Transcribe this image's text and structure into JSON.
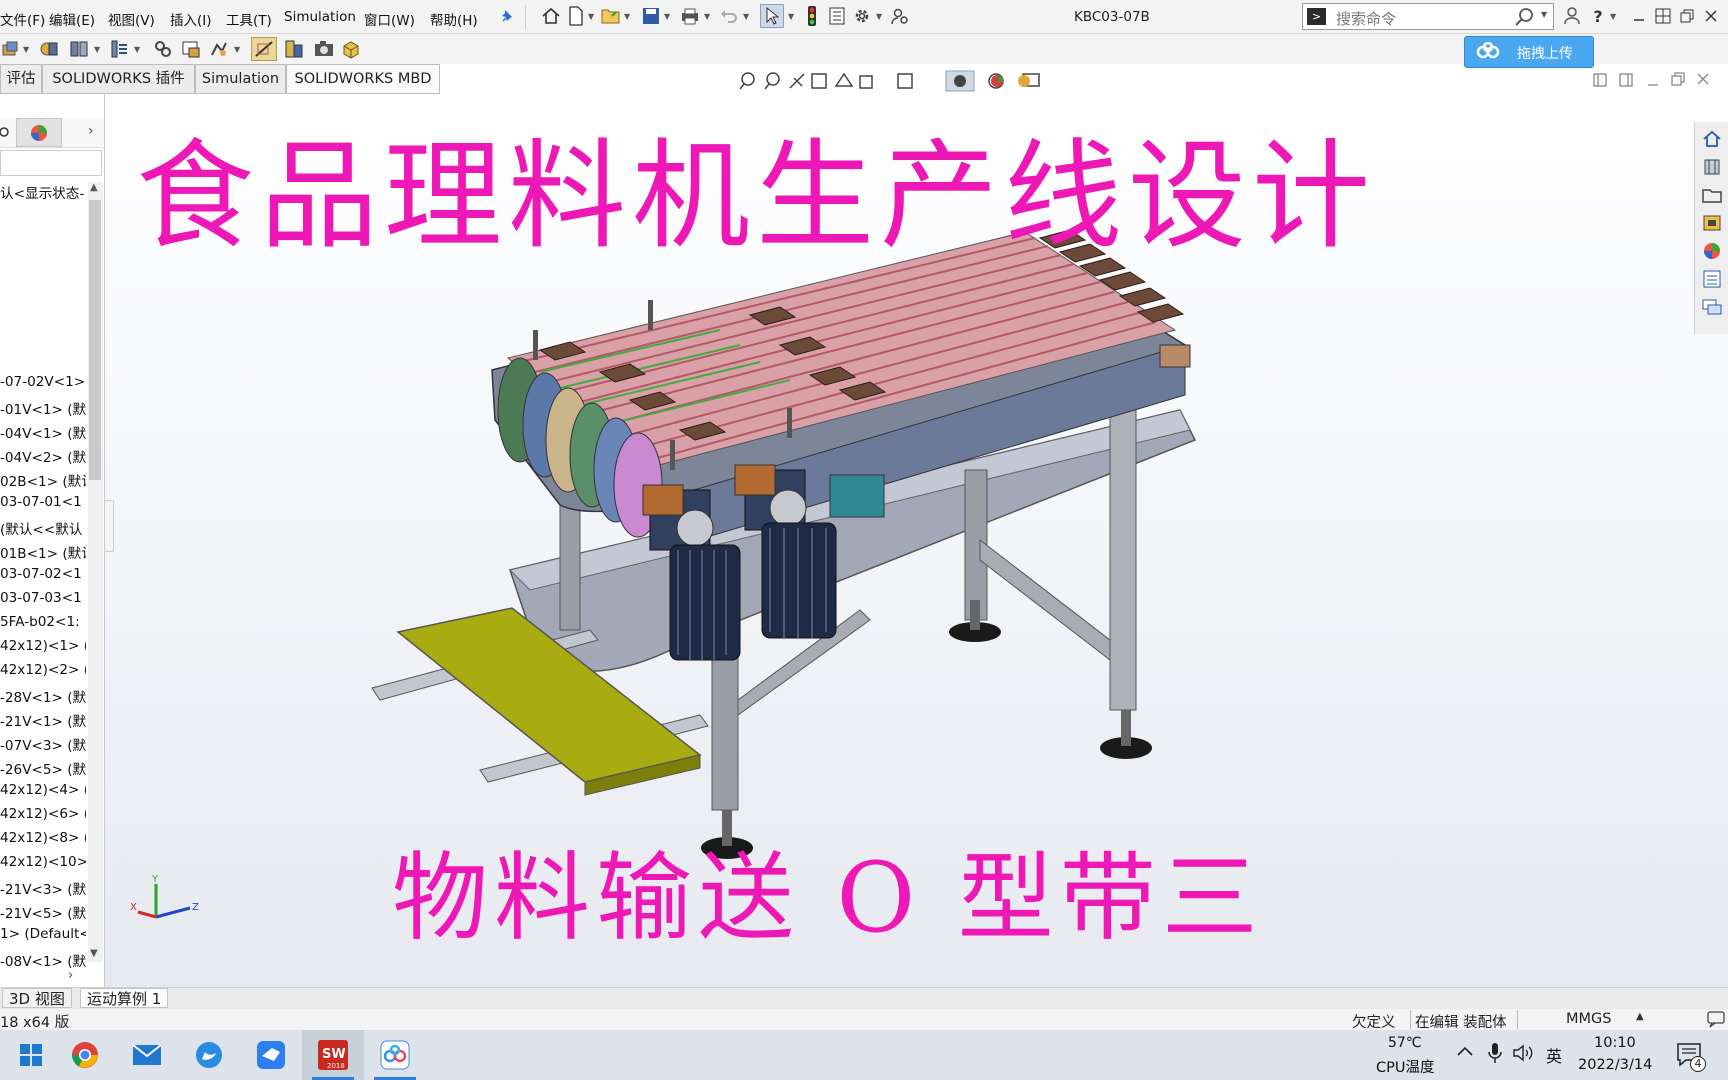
{
  "menubar": {
    "items": [
      "文件(F)",
      "编辑(E)",
      "视图(V)",
      "插入(I)",
      "工具(T)",
      "Simulation",
      "窗口(W)",
      "帮助(H)"
    ],
    "doc_title": "KBC03-07B",
    "search_placeholder": "搜索命令"
  },
  "toolbar": {
    "upload_label": "拖拽上传"
  },
  "command_tabs": [
    "评估",
    "SOLIDWORKS 插件",
    "Simulation",
    "SOLIDWORKS MBD"
  ],
  "feature_tree": {
    "top_item": "认<显示状态-",
    "items": [
      "-07-02V<1>",
      "-01V<1> (默",
      "-04V<1> (默",
      "-04V<2> (默",
      "02B<1> (默认",
      "03-07-01<1",
      "(默认<<默认",
      "01B<1> (默认",
      "03-07-02<1",
      "03-07-03<1",
      "5FA-b02<1:",
      "42x12)<1> (",
      "42x12)<2> (",
      "-28V<1> (默",
      "-21V<1> (默",
      "-07V<3> (默",
      "-26V<5> (默",
      "42x12)<4> (",
      "42x12)<6> (",
      "42x12)<8> (",
      "42x12)<10>",
      "-21V<3> (默",
      "-21V<5> (默",
      "1> (Default<",
      "-08V<1> (默"
    ]
  },
  "overlay": {
    "title": "食品理料机生产线设计",
    "subtitle": "物料输送 O 型带三"
  },
  "bottom_tabs": [
    "3D 视图",
    "运动算例 1"
  ],
  "status": {
    "version": "18 x64 版",
    "define": "欠定义",
    "mode": "在编辑 装配体",
    "units": "MMGS"
  },
  "taskbar": {
    "temp": "57℃",
    "temp_label": "CPU温度",
    "ime": "英",
    "time": "10:10",
    "date": "2022/3/14",
    "notif_count": "4",
    "sw_badge": "2018"
  },
  "colors": {
    "title_magenta": "#ee18b6",
    "upload_blue": "#4aa8f0"
  }
}
